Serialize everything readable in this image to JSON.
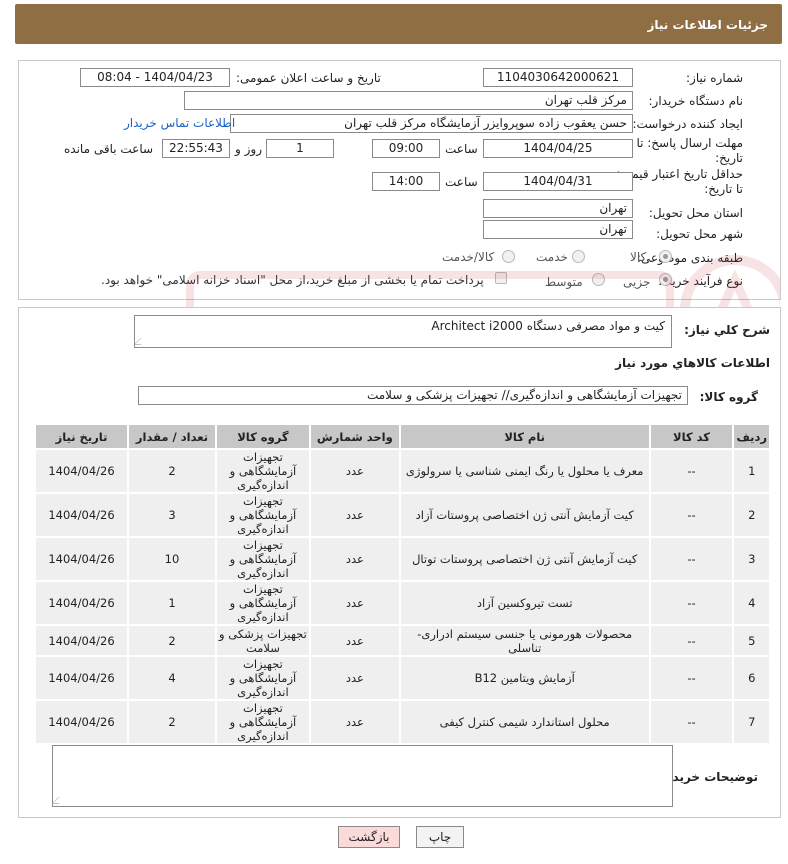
{
  "page_title": "جزئیات اطلاعات نیاز",
  "fields": {
    "need_number": {
      "label": "شماره نیاز:",
      "value": "1104030642000621"
    },
    "announce_datetime": {
      "label": "تاریخ و ساعت اعلان عمومی:",
      "value": "1404/04/23 - 08:04"
    },
    "buyer_org": {
      "label": "نام دستگاه خریدار:",
      "value": "مرکز قلب تهران"
    },
    "requester": {
      "label": "ایجاد کننده درخواست:",
      "value": "حسن یعقوب زاده سوپروایزر آزمایشگاه مرکز قلب تهران"
    },
    "contact_link": "اطلاعات تماس خریدار",
    "reply_deadline": {
      "label_1": "مهلت ارسال پاسخ: تا",
      "label_2": "تاریخ:",
      "date": "1404/04/25",
      "time_label": "ساعت",
      "time": "09:00",
      "days": "1",
      "days_label": "روز و",
      "remaining": "22:55:43",
      "remaining_label": "ساعت باقی مانده"
    },
    "price_validity": {
      "label_1": "حداقل تاریخ اعتبار قیمت:",
      "label_2": "تا تاریخ:",
      "date": "1404/04/31",
      "time_label": "ساعت",
      "time": "14:00"
    },
    "province": {
      "label": "استان محل تحویل:",
      "value": "تهران"
    },
    "city": {
      "label": "شهر محل تحویل:",
      "value": "تهران"
    },
    "category": {
      "label": "طبقه بندی موضوعی:",
      "options": [
        "کالا",
        "خدمت",
        "کالا/خدمت"
      ]
    },
    "process": {
      "label": "نوع فرآیند خرید :",
      "options": [
        "جزیی",
        "متوسط"
      ],
      "note": "پرداخت تمام یا بخشی از مبلغ خرید،از محل \"اسناد خزانه اسلامی\" خواهد بود."
    }
  },
  "description": {
    "label": "شرح کلي نياز:",
    "value": "کیت و مواد مصرفی دستگاه Architect i2000"
  },
  "goods_info_title": "اطلاعات کالاهاي مورد نياز",
  "goods_group": {
    "label": "گروه کالا:",
    "value": "تجهیزات آزمایشگاهی و اندازه‌گیری// تجهیزات پزشکی و سلامت"
  },
  "table": {
    "headers": [
      "ردیف",
      "کد کالا",
      "نام کالا",
      "واحد شمارش",
      "گروه کالا",
      "تعداد / مقدار",
      "تاریخ نیاز"
    ],
    "rows": [
      [
        "1",
        "--",
        "معرف یا محلول یا رنگ ایمنی شناسی یا سرولوژی",
        "عدد",
        "تجهیزات آزمایشگاهی و اندازه‌گیری",
        "2",
        "1404/04/26"
      ],
      [
        "2",
        "--",
        "کیت آزمایش آنتی ژن اختصاصی پروستات آزاد",
        "عدد",
        "تجهیزات آزمایشگاهی و اندازه‌گیری",
        "3",
        "1404/04/26"
      ],
      [
        "3",
        "--",
        "کیت آزمایش آنتی ژن اختصاصی پروستات توتال",
        "عدد",
        "تجهیزات آزمایشگاهی و اندازه‌گیری",
        "10",
        "1404/04/26"
      ],
      [
        "4",
        "--",
        "تست تیروکسین آزاد",
        "عدد",
        "تجهیزات آزمایشگاهی و اندازه‌گیری",
        "1",
        "1404/04/26"
      ],
      [
        "5",
        "--",
        "محصولات هورمونی یا جنسی سیستم ادراری-تناسلی",
        "عدد",
        "تجهیزات پزشکی و سلامت",
        "2",
        "1404/04/26"
      ],
      [
        "6",
        "--",
        "آزمایش ویتامین B12",
        "عدد",
        "تجهیزات آزمایشگاهی و اندازه‌گیری",
        "4",
        "1404/04/26"
      ],
      [
        "7",
        "--",
        "محلول استاندارد شیمی کنترل کیفی",
        "عدد",
        "تجهیزات آزمایشگاهی و اندازه‌گیری",
        "2",
        "1404/04/26"
      ]
    ]
  },
  "buyer_notes": {
    "label": "توضیحات خریدار:",
    "value": ""
  },
  "buttons": {
    "print": "چاپ",
    "back": "بازگشت"
  },
  "colors": {
    "header_bg": "#8f6e44",
    "link": "#1b62c4",
    "table_header": "#c7c7c7",
    "back_button": "#fbdada"
  }
}
